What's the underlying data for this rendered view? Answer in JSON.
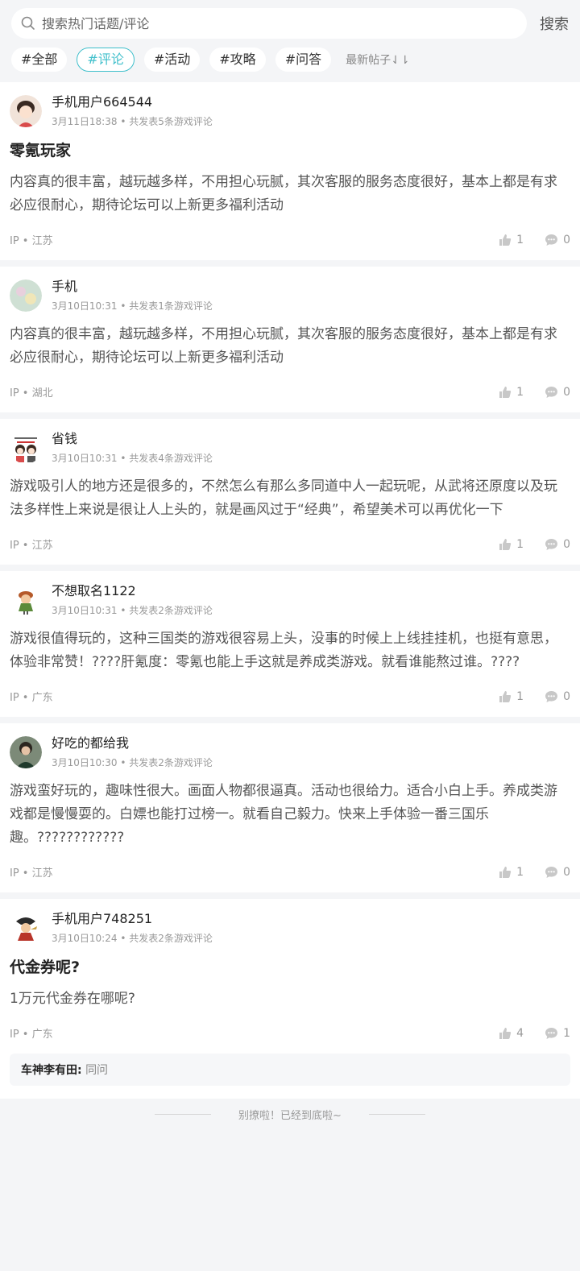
{
  "search": {
    "placeholder": "搜索热门话题/评论",
    "button": "搜索"
  },
  "tags": [
    "#全部",
    "#评论",
    "#活动",
    "#攻略",
    "#问答"
  ],
  "sort_label": "最新帖子⇃⇂",
  "posts": [
    {
      "user": "手机用户664544",
      "date": "3月11日18:38",
      "count": " • 共发表5条游戏评论",
      "title": "零氪玩家",
      "body": "内容真的很丰富，越玩越多样，不用担心玩腻，其次客服的服务态度很好，基本上都是有求必应很耐心，期待论坛可以上新更多福利活动",
      "ip": "IP • 江苏",
      "likes": "1",
      "comments": "0",
      "avatar_color": "#f1e3d9"
    },
    {
      "user": "手机",
      "date": "3月10日10:31",
      "count": " • 共发表1条游戏评论",
      "title": "",
      "body": "内容真的很丰富，越玩越多样，不用担心玩腻，其次客服的服务态度很好，基本上都是有求必应很耐心，期待论坛可以上新更多福利活动",
      "ip": "IP • 湖北",
      "likes": "1",
      "comments": "0",
      "avatar_color": "#cfe0d4"
    },
    {
      "user": "省钱",
      "date": "3月10日10:31",
      "count": " • 共发表4条游戏评论",
      "title": "",
      "body": "游戏吸引人的地方还是很多的，不然怎么有那么多同道中人一起玩呢，从武将还原度以及玩法多样性上来说是很让人上头的，就是画风过于“经典”，希望美术可以再优化一下",
      "ip": "IP • 江苏",
      "likes": "1",
      "comments": "0",
      "avatar_color": "#ffffff"
    },
    {
      "user": "不想取名1122",
      "date": "3月10日10:31",
      "count": " • 共发表2条游戏评论",
      "title": "",
      "body": "游戏很值得玩的，这种三国类的游戏很容易上头，没事的时候上上线挂挂机，也挺有意思，体验非常赞！????肝氪度：零氪也能上手这就是养成类游戏。就看谁能熬过谁。????",
      "ip": "IP • 广东",
      "likes": "1",
      "comments": "0",
      "avatar_color": "#ffffff"
    },
    {
      "user": "好吃的都给我",
      "date": "3月10日10:30",
      "count": " • 共发表2条游戏评论",
      "title": "",
      "body": "游戏蛮好玩的，趣味性很大。画面人物都很逼真。活动也很给力。适合小白上手。养成类游戏都是慢慢耍的。白嫖也能打过榜一。就看自己毅力。快来上手体验一番三国乐趣。????????????",
      "ip": "IP • 江苏",
      "likes": "1",
      "comments": "0",
      "avatar_color": "#4a5a4a"
    },
    {
      "user": "手机用户748251",
      "date": "3月10日10:24",
      "count": " • 共发表2条游戏评论",
      "title": "代金券呢?",
      "body": "1万元代金券在哪呢?",
      "ip": "IP • 广东",
      "likes": "4",
      "comments": "1",
      "avatar_color": "#ffffff",
      "reply": {
        "name": "车神李有田:",
        "text": "同问"
      }
    }
  ],
  "end_text": "别撩啦！已经到底啦~"
}
